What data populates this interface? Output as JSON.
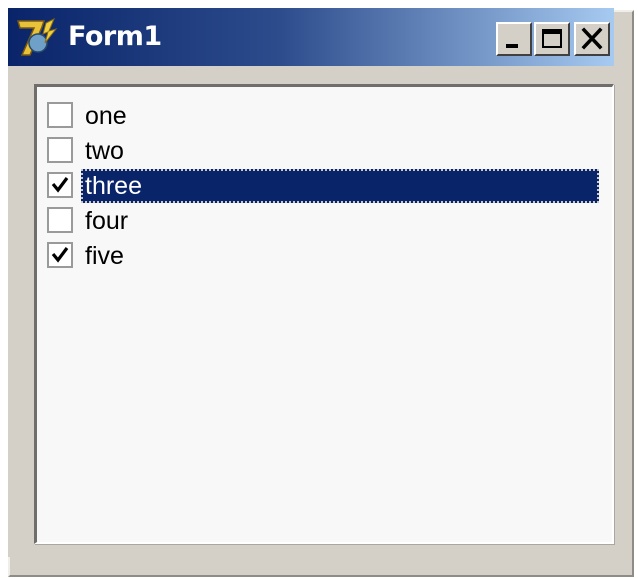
{
  "window": {
    "title": "Form1"
  },
  "titlebar": {
    "icon": "delphi-app-icon",
    "buttons": [
      {
        "name": "minimize",
        "icon": "minimize-icon"
      },
      {
        "name": "maximize",
        "icon": "maximize-icon"
      },
      {
        "name": "close",
        "icon": "close-icon"
      }
    ]
  },
  "checklist": {
    "items": [
      {
        "label": "one",
        "checked": false,
        "selected": false
      },
      {
        "label": "two",
        "checked": false,
        "selected": false
      },
      {
        "label": "three",
        "checked": true,
        "selected": true
      },
      {
        "label": "four",
        "checked": false,
        "selected": false
      },
      {
        "label": "five",
        "checked": true,
        "selected": false
      }
    ]
  },
  "colors": {
    "titlebar_start": "#0a246a",
    "titlebar_end": "#a6caf0",
    "selection": "#0a246a",
    "face": "#d4d0c8"
  }
}
